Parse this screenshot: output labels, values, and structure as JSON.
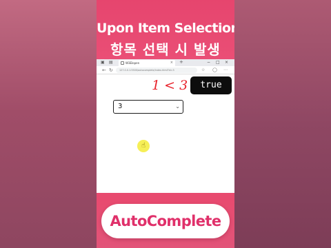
{
  "header": {
    "title_en": "Upon Item Selection",
    "title_ko": "항목 선택 시 발생"
  },
  "browser": {
    "tab_title": "W3Elopen",
    "tab_close": "×",
    "new_tab": "+",
    "window_controls": [
      "−",
      "□",
      "×"
    ],
    "url": "127.0.0.1:5500/autocomplete/index.html?id=3",
    "nav_icons": [
      "back-icon",
      "refresh-icon"
    ],
    "tool_icons": [
      "star-icon",
      "profile-icon",
      "menu-icon"
    ]
  },
  "page": {
    "comparison": "1 < 3",
    "result": "true",
    "select_value": "3",
    "select_arrow": "⌄",
    "cursor_glyph": "☝"
  },
  "footer": {
    "label": "AutoComplete"
  },
  "colors": {
    "accent_pink": "#e6456e",
    "comparison_red": "#e8232c",
    "badge_black": "#0d0d0d",
    "cursor_yellow": "#f6ef57",
    "pill_text": "#e0306a"
  }
}
